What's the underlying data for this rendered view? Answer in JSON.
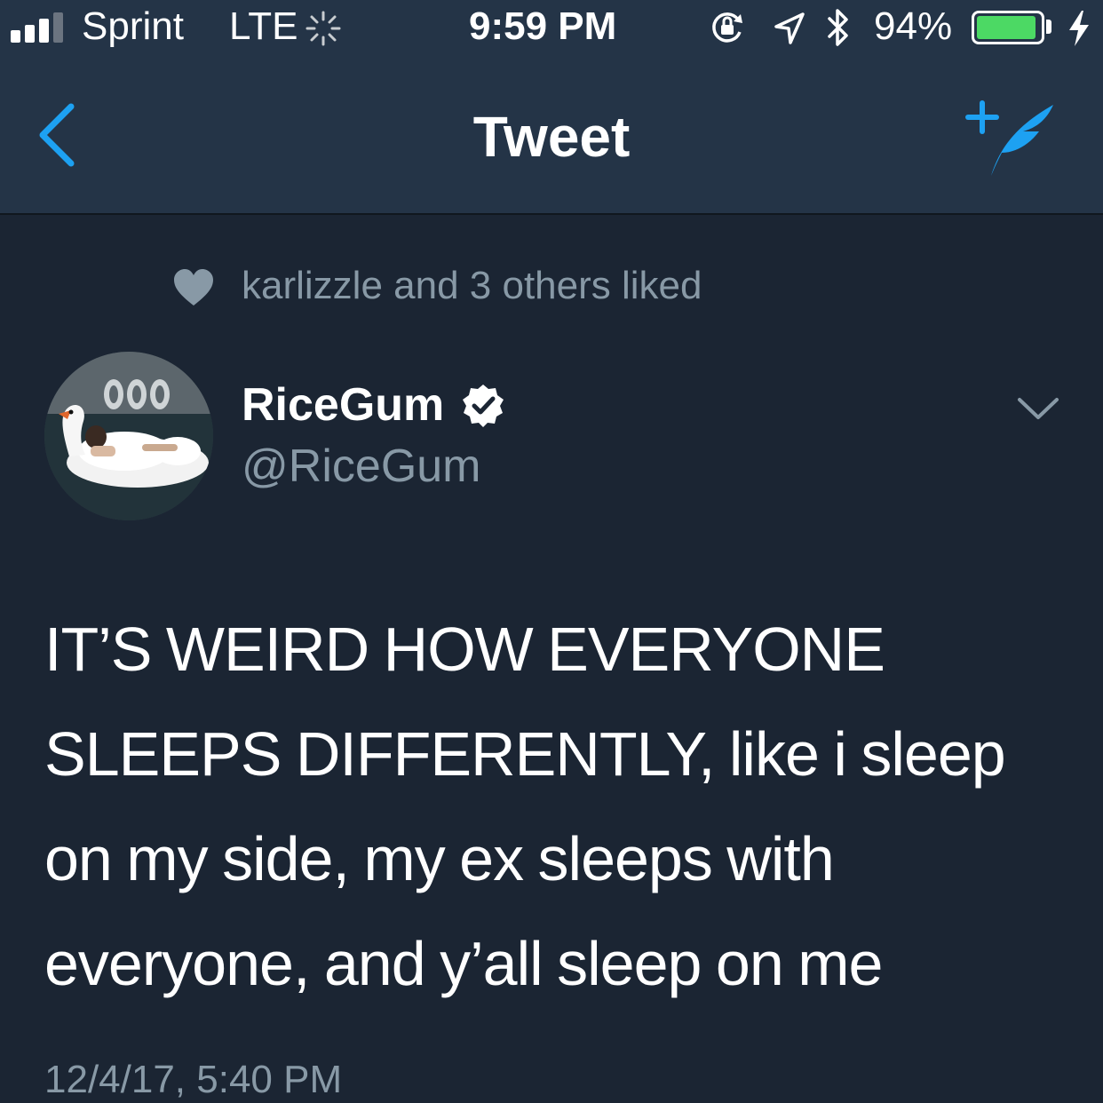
{
  "status_bar": {
    "carrier": "Sprint",
    "network": "LTE",
    "time": "9:59 PM",
    "battery_percent": "94%",
    "battery_level": 0.94,
    "signal_bars_filled": 3,
    "signal_bars_total": 4,
    "icons": [
      "signal-icon",
      "activity-icon",
      "orientation-lock-icon",
      "location-icon",
      "bluetooth-icon",
      "battery-icon",
      "charging-icon"
    ]
  },
  "nav": {
    "title": "Tweet",
    "back_icon": "chevron-left-icon",
    "compose_icon": "compose-tweet-icon",
    "accent_color": "#1da1f2"
  },
  "tweet": {
    "social_context": "karlizzle and 3 others liked",
    "social_context_icon": "heart-icon",
    "author": {
      "display_name": "RiceGum",
      "handle": "@RiceGum",
      "verified": true
    },
    "text_lines": [
      "IT’S  WEIRD HOW EVERYONE",
      "SLEEPS DIFFERENTLY, like i sleep",
      "on my side, my ex sleeps with",
      "everyone, and y’all sleep on me"
    ],
    "timestamp": "12/4/17, 5:40 PM"
  },
  "colors": {
    "background": "#1b2533",
    "bar_background": "#243447",
    "secondary_text": "#8899a6",
    "battery_green": "#4cd964"
  }
}
